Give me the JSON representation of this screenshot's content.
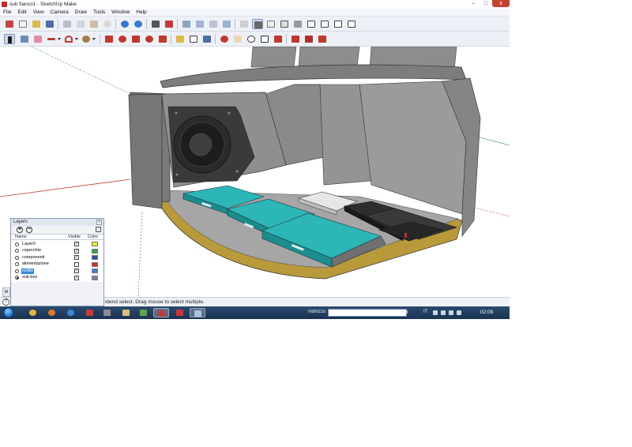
{
  "window": {
    "title": "sub fianco1 - SketchUp Make",
    "controls": {
      "minimize": "–",
      "maximize": "□",
      "close": "x"
    }
  },
  "menubar": {
    "items": [
      "File",
      "Edit",
      "View",
      "Camera",
      "Draw",
      "Tools",
      "Window",
      "Help"
    ]
  },
  "layers_panel": {
    "title": "Layers",
    "close_glyph": "x",
    "add_glyph": "+",
    "remove_glyph": "−",
    "columns": {
      "name": "Name",
      "visible": "Visible",
      "color": "Color"
    },
    "rows": [
      {
        "name": "Layer0",
        "active": false,
        "visible": true,
        "color": "#e9ee2a",
        "selected": false
      },
      {
        "name": "coperchio",
        "active": false,
        "visible": true,
        "color": "#2fa64a",
        "selected": false
      },
      {
        "name": "componenti",
        "active": false,
        "visible": true,
        "color": "#2a4fb5",
        "selected": false
      },
      {
        "name": "alimentazione",
        "active": false,
        "visible": false,
        "color": "#d62a22",
        "selected": false
      },
      {
        "name": "sedile",
        "active": false,
        "visible": true,
        "color": "#4a7bd8",
        "selected": true
      },
      {
        "name": "sub box",
        "active": true,
        "visible": true,
        "color": "#7a7fa8",
        "selected": false
      }
    ]
  },
  "statusbar": {
    "help_glyph": "?",
    "tab_label": "M",
    "message": "xtend select. Drag mouse to select multiple."
  },
  "taskbar": {
    "address_label": "Indirizzo",
    "address_arrows": "▾ ↯",
    "language": "IT",
    "clock": "02:08"
  },
  "colors": {
    "model_gray": "#8c8c8c",
    "amp_teal": "#1fa6a6",
    "floor_wood": "#b89a3a",
    "axis_red": "#c0392b",
    "axis_green": "#2e8b57",
    "axis_blue": "#3b5ccc"
  }
}
